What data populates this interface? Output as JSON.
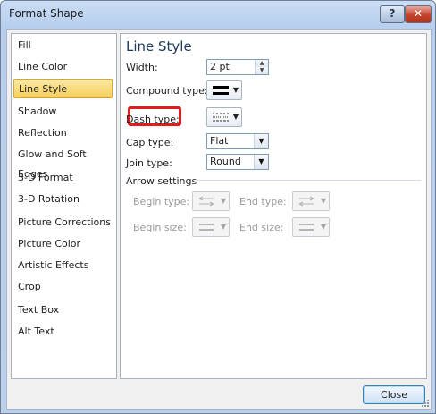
{
  "window": {
    "title": "Format Shape",
    "help_label": "?",
    "close_label": "✕"
  },
  "sidebar": {
    "items": [
      {
        "label": "Fill"
      },
      {
        "label": "Line Color"
      },
      {
        "label": "Line Style",
        "selected": true
      },
      {
        "label": "Shadow"
      },
      {
        "label": "Reflection"
      },
      {
        "label": "Glow and Soft Edges"
      },
      {
        "label": "3-D Format"
      },
      {
        "label": "3-D Rotation"
      },
      {
        "label": "Picture Corrections"
      },
      {
        "label": "Picture Color"
      },
      {
        "label": "Artistic Effects"
      },
      {
        "label": "Crop"
      },
      {
        "label": "Text Box"
      },
      {
        "label": "Alt Text"
      }
    ]
  },
  "panel": {
    "title": "Line Style",
    "width": {
      "label": "Width:",
      "value": "2 pt"
    },
    "compound_type": {
      "label": "Compound type:"
    },
    "dash_type": {
      "label": "Dash type:"
    },
    "cap_type": {
      "label": "Cap type:",
      "value": "Flat"
    },
    "join_type": {
      "label": "Join type:",
      "value": "Round"
    },
    "arrow_settings": {
      "label": "Arrow settings",
      "begin_type": "Begin type:",
      "end_type": "End type:",
      "begin_size": "Begin size:",
      "end_size": "End size:"
    }
  },
  "footer": {
    "close_label": "Close"
  },
  "colors": {
    "highlight": "#e31b1b",
    "selected": "#f6cf5c"
  }
}
